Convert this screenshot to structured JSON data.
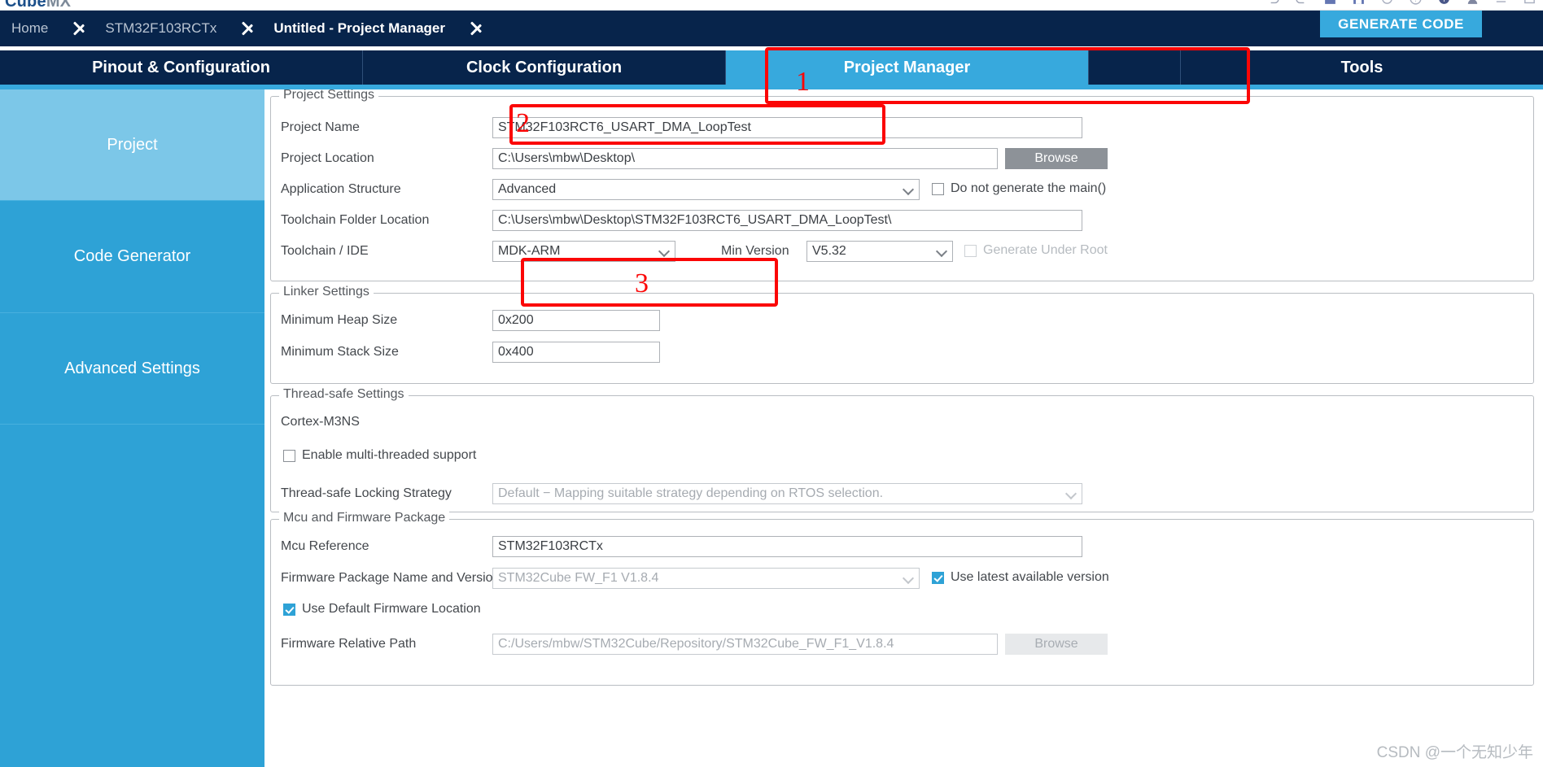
{
  "app": {
    "brand_main": "Cube",
    "brand_suffix": "MX"
  },
  "toolbar": {
    "icons": [
      "undo-icon",
      "redo-icon",
      "save-icon",
      "save-as-icon",
      "power-icon",
      "help-icon",
      "info-icon",
      "user-icon",
      "minimize-icon",
      "maximize-icon"
    ]
  },
  "breadcrumb": {
    "items": [
      {
        "label": "Home",
        "active": false
      },
      {
        "label": "STM32F103RCTx",
        "active": false
      },
      {
        "label": "Untitled - Project Manager",
        "active": true
      }
    ],
    "generate_code_label": "GENERATE CODE"
  },
  "tabs": [
    {
      "label": "Pinout & Configuration",
      "selected": false
    },
    {
      "label": "Clock Configuration",
      "selected": false
    },
    {
      "label": "Project Manager",
      "selected": true
    },
    {
      "label": "Tools",
      "selected": false
    }
  ],
  "sidebar": {
    "items": [
      {
        "label": "Project",
        "selected": true
      },
      {
        "label": "Code Generator",
        "selected": false
      },
      {
        "label": "Advanced Settings",
        "selected": false
      }
    ]
  },
  "project_settings": {
    "title": "Project Settings",
    "project_name": {
      "label": "Project Name",
      "value": "STM32F103RCT6_USART_DMA_LoopTest"
    },
    "project_location": {
      "label": "Project Location",
      "value": "C:\\Users\\mbw\\Desktop\\",
      "browse_label": "Browse"
    },
    "application_structure": {
      "label": "Application Structure",
      "value": "Advanced"
    },
    "do_not_generate_main": {
      "label": "Do not generate the main()",
      "checked": false
    },
    "toolchain_folder_location": {
      "label": "Toolchain Folder Location",
      "value": "C:\\Users\\mbw\\Desktop\\STM32F103RCT6_USART_DMA_LoopTest\\"
    },
    "toolchain_ide": {
      "label": "Toolchain / IDE",
      "value": "MDK-ARM"
    },
    "min_version": {
      "label": "Min Version",
      "value": "V5.32"
    },
    "generate_under_root": {
      "label": "Generate Under Root",
      "checked": false,
      "disabled": true
    }
  },
  "linker_settings": {
    "title": "Linker Settings",
    "minimum_heap_size": {
      "label": "Minimum Heap Size",
      "value": "0x200"
    },
    "minimum_stack_size": {
      "label": "Minimum Stack Size",
      "value": "0x400"
    }
  },
  "thread_safe_settings": {
    "title": "Thread-safe Settings",
    "core_label": "Cortex-M3NS",
    "enable_multi_threaded": {
      "label": "Enable multi-threaded support",
      "checked": false
    },
    "locking_strategy": {
      "label": "Thread-safe Locking Strategy",
      "value": "Default − Mapping suitable strategy depending on RTOS selection."
    }
  },
  "mcu_firmware_package": {
    "title": "Mcu and Firmware Package",
    "mcu_reference": {
      "label": "Mcu Reference",
      "value": "STM32F103RCTx"
    },
    "firmware_package": {
      "label": "Firmware Package Name and Version",
      "value": "STM32Cube FW_F1 V1.8.4"
    },
    "use_latest_version": {
      "label": "Use latest available version",
      "checked": true
    },
    "use_default_firmware_location": {
      "label": "Use Default Firmware Location",
      "checked": true
    },
    "firmware_relative_path": {
      "label": "Firmware Relative Path",
      "value": "C:/Users/mbw/STM32Cube/Repository/STM32Cube_FW_F1_V1.8.4",
      "browse_label": "Browse"
    }
  },
  "annotations": {
    "color": "#fb0606",
    "markers": [
      {
        "id": "1",
        "target": "project-manager-tab"
      },
      {
        "id": "2",
        "target": "project-name-field"
      },
      {
        "id": "3",
        "target": "toolchain-ide-field"
      }
    ]
  },
  "watermark": {
    "text": "CSDN @一个无知少年"
  }
}
